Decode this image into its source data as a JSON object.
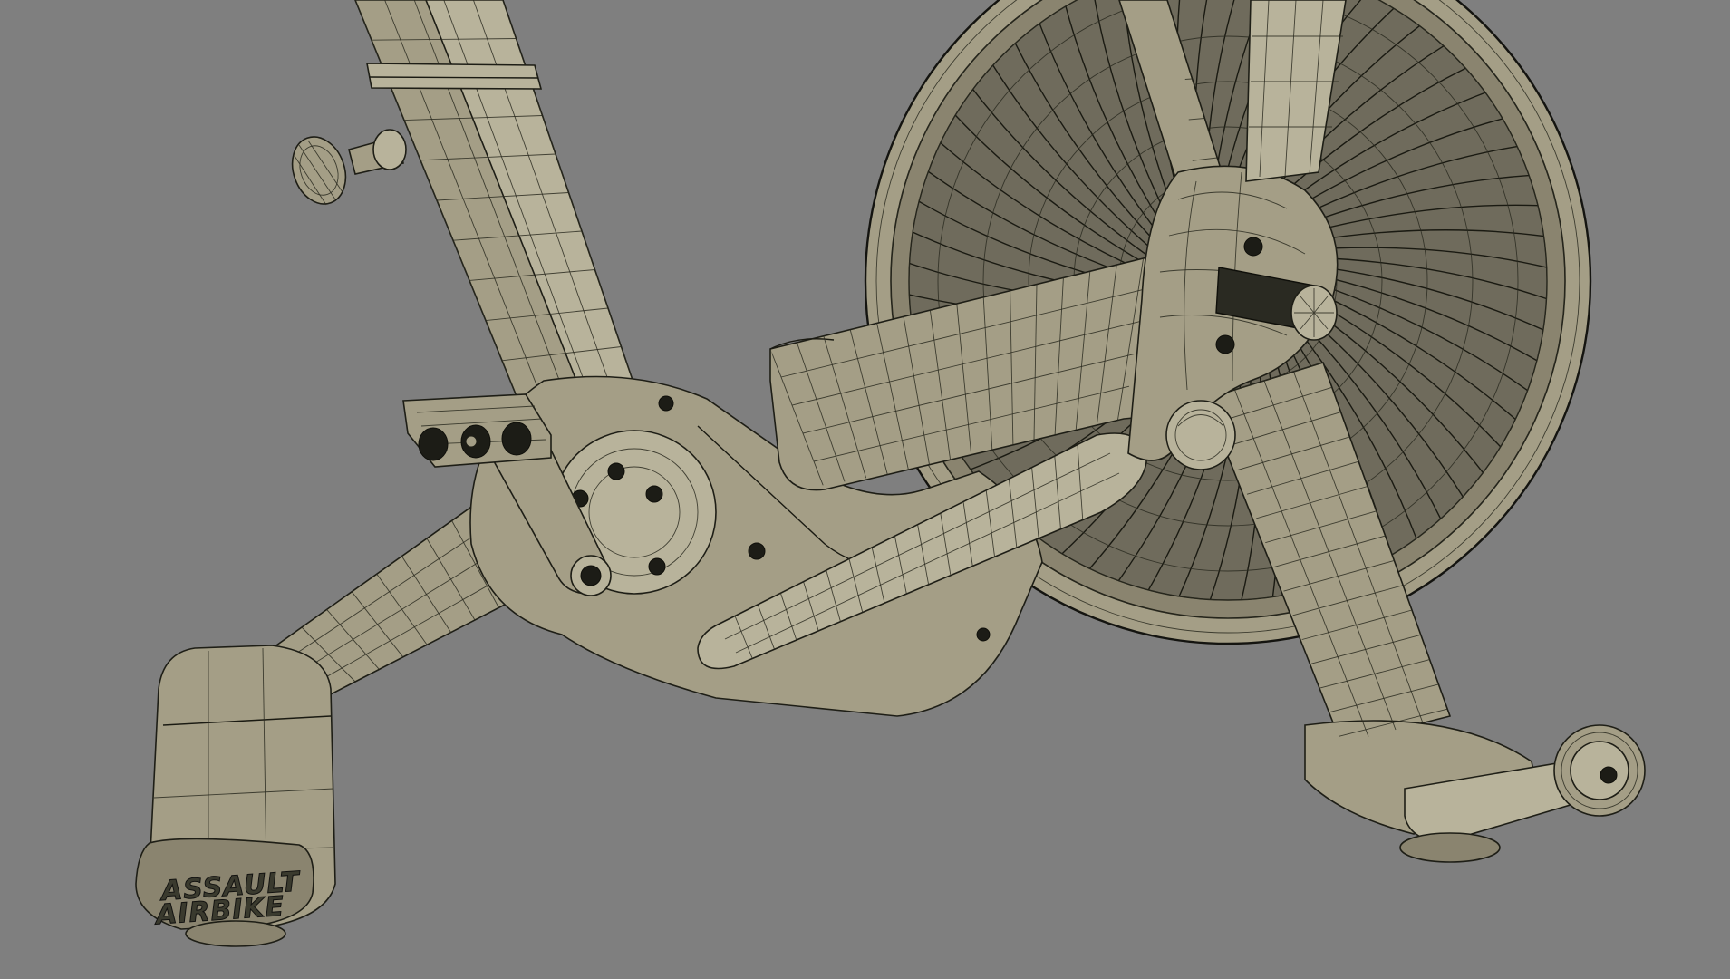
{
  "viewport": {
    "background_color": "#7f7f7f",
    "model_fill_color": "#a49e86",
    "wireframe_color": "#1e1e16"
  },
  "model": {
    "logo": {
      "line1": "ASSAULT",
      "line2": "AIRBIKE"
    }
  }
}
